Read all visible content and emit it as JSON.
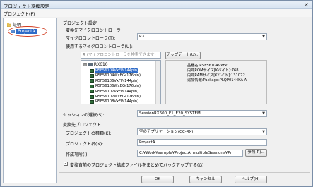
{
  "window": {
    "title": "プロジェクト変換設定",
    "close_glyph": "×"
  },
  "menu": {
    "project_label": "プロジェクト(P)"
  },
  "tree": {
    "root_label": "証明",
    "project_label": "ProjectA"
  },
  "settings": {
    "section_title": "プロジェクト設定",
    "target_mcu_group": "変換先マイクロコントローラ",
    "mcu_label": "マイクロコントローラ(T):",
    "mcu_value": "RX",
    "usable_mcu_label": "使用するマイクロコントローラ(U):",
    "search_placeholder": "(マイクロコントローラを検索できます)",
    "update_button": "アップデート(U)...",
    "tree_group": "RX610",
    "devices": [
      "R5F56104VxFP(144pin)",
      "R5F56104WxBG(176pin)",
      "R5F56106VxFP(144pin)",
      "R5F56106WxBG(176pin)",
      "R5F56107VxFP(144pin)",
      "R5F56107WxBG(176pin)",
      "R5F56108VxFP(144pin)"
    ],
    "info_lines": [
      "品種名:R5F56104VxFP",
      "内蔵ROMサイズ[Kバイト]:768",
      "内蔵RAMサイズ[Kバイト]:131072",
      "追加情報:Package:PLQP0144KA-A"
    ],
    "session_label": "セッションの選択(S):",
    "session_value": "SessionRX600_E1_E20_SYSTEM",
    "target_project_group": "変換先プロジェクト",
    "project_type_label": "プロジェクトの種類(K):",
    "project_type_value": "空のアプリケーション(CC-RX)",
    "project_name_label": "プロジェクト名(N):",
    "project_name_value": "ProjectA",
    "location_label": "作成場所(I):",
    "location_value": "C:¥Work¥sample¥ProjectA_multipleSessions¥Pr",
    "browse_button": "参照(R)...",
    "backup_checkbox": "変換直前のプロジェクト構成ファイルをまとめてバックアップする(G)",
    "backup_checked": true
  },
  "buttons": {
    "ok": "OK",
    "cancel": "キャンセル",
    "help": "ヘルプ(H)"
  }
}
